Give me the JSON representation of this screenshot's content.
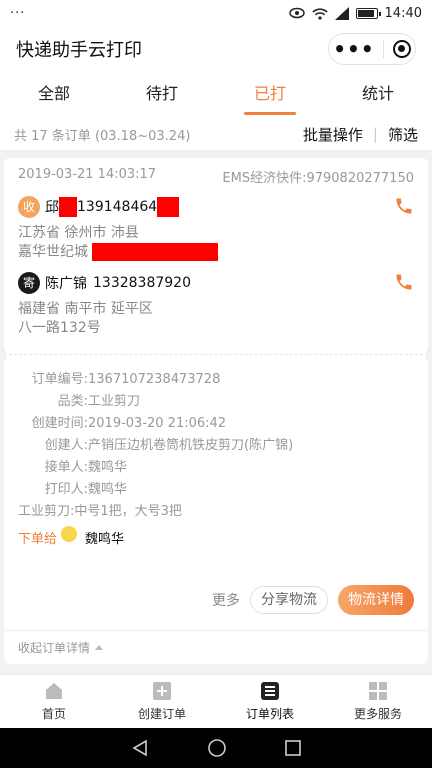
{
  "status_bar": {
    "left": "···",
    "time": "14:40"
  },
  "app": {
    "title": "快递助手云打印"
  },
  "tabs": [
    {
      "label": "全部"
    },
    {
      "label": "待打"
    },
    {
      "label": "已打",
      "active": true
    },
    {
      "label": "统计"
    }
  ],
  "summary": {
    "count_text": "共 17 条订单 (03.18~03.24)",
    "batch_label": "批量操作",
    "filter_label": "筛选"
  },
  "order": {
    "time": "2019-03-21 14:03:17",
    "express": "EMS经济快件:9790820277150",
    "receiver": {
      "badge": "收",
      "name": "邱",
      "phone": "139148464",
      "address_line1": "江苏省 徐州市 沛县",
      "address_line2": "嘉华世纪城"
    },
    "sender": {
      "badge": "寄",
      "name": "陈广锦",
      "phone": "13328387920",
      "address_line1": "福建省 南平市 延平区",
      "address_line2": "八一路132号"
    },
    "details": [
      {
        "key": "订单编号:",
        "value": "1367107238473728"
      },
      {
        "key": "品类:",
        "value": "工业剪刀"
      },
      {
        "key": "创建时间:",
        "value": "2019-03-20 21:06:42"
      },
      {
        "key": "创建人:",
        "value": "产销压边机卷筒机铁皮剪刀(陈广锦)"
      },
      {
        "key": "接单人:",
        "value": "魏鸣华"
      },
      {
        "key": "打印人:",
        "value": "魏鸣华"
      }
    ],
    "goods_line": "工业剪刀:中号1把，大号3把",
    "assign_label": "下单给",
    "assign_name": "魏鸣华",
    "more_label": "更多",
    "share_label": "分享物流",
    "detail_label": "物流详情",
    "collapse_label": "收起订单详情"
  },
  "bottom_nav": [
    {
      "label": "首页",
      "icon": "home-icon"
    },
    {
      "label": "创建订单",
      "icon": "plus-square-icon"
    },
    {
      "label": "订单列表",
      "icon": "list-icon",
      "active": true
    },
    {
      "label": "更多服务",
      "icon": "grid-icon"
    }
  ],
  "colors": {
    "accent": "#f0803c",
    "redaction": "#ff0000"
  }
}
